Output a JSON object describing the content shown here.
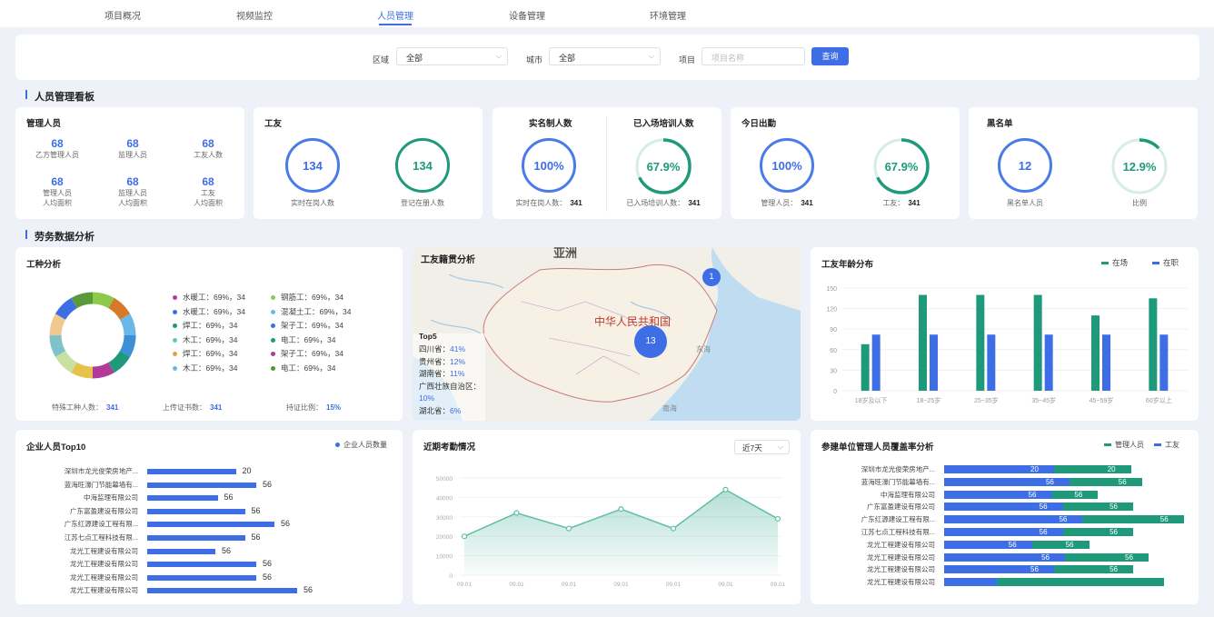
{
  "nav": {
    "tabs": [
      "项目概况",
      "视频监控",
      "人员管理",
      "设备管理",
      "环境管理"
    ],
    "active": 2
  },
  "filters": {
    "area_label": "区域",
    "area_value": "全部",
    "city_label": "城市",
    "city_value": "全部",
    "project_label": "项目",
    "project_placeholder": "项目名称",
    "query_button": "查询"
  },
  "section1_title": "人员管理看板",
  "section2_title": "劳务数据分析",
  "managers": {
    "title": "管理人员",
    "items": [
      {
        "value": "68",
        "label": "乙方管理人员"
      },
      {
        "value": "68",
        "label": "监理人员"
      },
      {
        "value": "68",
        "label": "工友人数"
      },
      {
        "value": "68",
        "label": "管理人员\n人均面积"
      },
      {
        "value": "68",
        "label": "监理人员\n人均面积"
      },
      {
        "value": "68",
        "label": "工友\n人均面积"
      }
    ]
  },
  "workers": {
    "title": "工友",
    "ring1_value": "134",
    "ring1_label": "实时在岗人数",
    "ring2_value": "134",
    "ring2_label": "登记在册人数"
  },
  "realname": {
    "title1": "实名制人数",
    "title2": "已入场培训人数",
    "ring1_value": "100%",
    "ring1_label": "实时在岗人数：",
    "ring1_count": "341",
    "ring2_value": "67.9%",
    "ring2_label": "已入场培训人数：",
    "ring2_count": "341",
    "ring2_progress": 0.679
  },
  "attendance": {
    "title": "今日出勤",
    "ring1_value": "100%",
    "ring1_label": "管理人员：",
    "ring1_count": "341",
    "ring2_value": "67.9%",
    "ring2_label": "工友：",
    "ring2_count": "341",
    "ring2_progress": 0.679
  },
  "blacklist": {
    "title": "黑名单",
    "ring1_value": "12",
    "ring1_label": "黑名单人员",
    "ring2_value": "12.9%",
    "ring2_label": "比例",
    "ring2_progress": 0.129
  },
  "job_types": {
    "title": "工种分析",
    "legend_left": [
      {
        "text": "水暖工：69%，34",
        "color": "#b23a9a"
      },
      {
        "text": "水暖工：69%，34",
        "color": "#3d6ee6"
      },
      {
        "text": "焊工：69%，34",
        "color": "#1e9a7b"
      },
      {
        "text": "木工：69%，34",
        "color": "#5ec8c0"
      },
      {
        "text": "焊工：69%，34",
        "color": "#e6a04a"
      },
      {
        "text": "木工：69%，34",
        "color": "#6ab7e8"
      }
    ],
    "legend_right": [
      {
        "text": "钢筋工：69%，34",
        "color": "#8dc94a"
      },
      {
        "text": "混凝土工：69%，34",
        "color": "#6ab7e8"
      },
      {
        "text": "架子工：69%，34",
        "color": "#3d6ee6"
      },
      {
        "text": "电工：69%，34",
        "color": "#1e9a7b"
      },
      {
        "text": "架子工：69%，34",
        "color": "#b23a9a"
      },
      {
        "text": "电工：69%，34",
        "color": "#4a9a3a"
      }
    ],
    "foot1_label": "特殊工种人数：",
    "foot1_value": "341",
    "foot2_label": "上传证书数：",
    "foot2_value": "341",
    "foot3_label": "持证比例：",
    "foot3_value": "15%"
  },
  "origin": {
    "title": "工友籍贯分析",
    "map_label_asia": "亚洲",
    "map_label_china": "中华人民共和国",
    "map_label_east_sea": "东海",
    "map_label_south_sea": "南海",
    "bubble1": "1",
    "bubble2": "13",
    "top5_title": "Top5",
    "top5": [
      {
        "name": "四川省：",
        "value": "41%"
      },
      {
        "name": "贵州省：",
        "value": "12%"
      },
      {
        "name": "湖南省：",
        "value": "11%"
      },
      {
        "name": "广西壮族自治区：",
        "value": "10%"
      },
      {
        "name": "湖北省：",
        "value": "6%"
      }
    ]
  },
  "age": {
    "title": "工友年龄分布",
    "legend": [
      {
        "name": "在场",
        "color": "#1e9a7b"
      },
      {
        "name": "在职",
        "color": "#3d6ee6"
      }
    ]
  },
  "top10": {
    "title": "企业人员Top10",
    "legend": "企业人员数量"
  },
  "recent_att": {
    "title": "近期考勤情况",
    "select_value": "近7天"
  },
  "coverage": {
    "title": "参建单位管理人员覆盖率分析",
    "legend": [
      {
        "name": "管理人员",
        "color": "#1e9a7b"
      },
      {
        "name": "工友",
        "color": "#3d6ee6"
      }
    ]
  },
  "chart_data": [
    {
      "type": "pie",
      "title": "工种分析",
      "categories": [
        "水暖工",
        "水暖工",
        "焊工",
        "木工",
        "焊工",
        "木工",
        "钢筋工",
        "混凝土工",
        "架子工",
        "电工",
        "架子工",
        "电工"
      ],
      "values": [
        34,
        34,
        34,
        34,
        34,
        34,
        34,
        34,
        34,
        34,
        34,
        34
      ]
    },
    {
      "type": "bar",
      "title": "工友年龄分布",
      "categories": [
        "18岁及以下",
        "18~25岁",
        "25~35岁",
        "35~45岁",
        "45~59岁",
        "60岁以上"
      ],
      "series": [
        {
          "name": "在场",
          "values": [
            68,
            140,
            140,
            140,
            110,
            135
          ]
        },
        {
          "name": "在职",
          "values": [
            82,
            82,
            82,
            82,
            82,
            82
          ]
        }
      ],
      "ylim": [
        0,
        150
      ],
      "yticks": [
        "0",
        "30",
        "60",
        "90",
        "120",
        "150"
      ],
      "colors": [
        "#1e9a7b",
        "#3d6ee6"
      ]
    },
    {
      "type": "bar",
      "orientation": "horizontal",
      "title": "企业人员Top10",
      "categories": [
        "深圳市龙光俊荣房地产...",
        "蓝海旺濠门节能幕墙有...",
        "中海监理有限公司",
        "广东富盈建设有限公司",
        "广东红源建设工程有限...",
        "江苏七点工程科技有限...",
        "龙光工程建设有限公司",
        "龙光工程建设有限公司",
        "龙光工程建设有限公司",
        "龙光工程建设有限公司"
      ],
      "series": [
        {
          "name": "企业人员数量",
          "values": [
            20,
            56,
            56,
            56,
            56,
            56,
            56,
            56,
            56,
            56
          ],
          "labels": [
            "20",
            "56",
            "56",
            "56",
            "56",
            "56",
            "56",
            "56",
            "56",
            "56"
          ],
          "fill": [
            0.39,
            0.48,
            0.31,
            0.43,
            0.56,
            0.43,
            0.3,
            0.48,
            0.48,
            0.66
          ]
        }
      ]
    },
    {
      "type": "area",
      "title": "近期考勤情况",
      "categories": [
        "09.01",
        "09.01",
        "09.01",
        "09.01",
        "09.01",
        "09.01",
        "09.01"
      ],
      "values": [
        20000,
        32000,
        24000,
        34000,
        24000,
        44000,
        29000
      ],
      "ylim": [
        0,
        50000
      ],
      "yticks": [
        "0",
        "10000",
        "20000",
        "30000",
        "40000",
        "50000"
      ]
    },
    {
      "type": "bar",
      "orientation": "horizontal",
      "stacked": true,
      "title": "参建单位管理人员覆盖率分析",
      "categories": [
        "深圳市龙光俊荣房地产...",
        "蓝海旺濠门节能幕墙有...",
        "中海监理有限公司",
        "广东富盈建设有限公司",
        "广东红源建设工程有限...",
        "江苏七点工程科技有限...",
        "龙光工程建设有限公司",
        "龙光工程建设有限公司",
        "龙光工程建设有限公司",
        "龙光工程建设有限公司"
      ],
      "series": [
        {
          "name": "工友",
          "values": [
            20,
            56,
            56,
            56,
            56,
            56,
            56,
            56,
            56,
            56
          ],
          "labels": [
            "20",
            "56",
            "56",
            "56",
            "56",
            "56",
            "56",
            "56",
            "56",
            ""
          ],
          "fill": [
            0.5,
            0.57,
            0.49,
            0.54,
            0.63,
            0.54,
            0.4,
            0.55,
            0.5,
            0.24
          ]
        },
        {
          "name": "管理人员",
          "values": [
            20,
            56,
            56,
            56,
            56,
            56,
            56,
            56,
            56,
            56
          ],
          "labels": [
            "20",
            "56",
            "56",
            "56",
            "56",
            "56",
            "56",
            "56",
            "56",
            ""
          ],
          "fill": [
            0.35,
            0.33,
            0.21,
            0.32,
            0.46,
            0.32,
            0.26,
            0.38,
            0.36,
            0.76
          ]
        }
      ]
    }
  ]
}
